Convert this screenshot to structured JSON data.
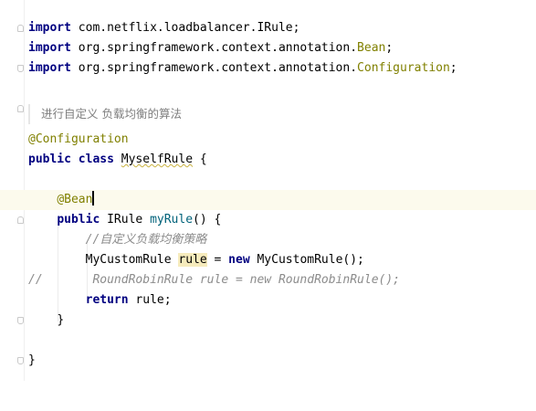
{
  "editor": {
    "imports": {
      "line1": {
        "kw": "import",
        "path": "com.netflix.loadbalancer.IRule;"
      },
      "line2": {
        "kw": "import",
        "path_a": "org.springframework.context.annotation.",
        "path_b": "Bean",
        "path_c": ";"
      },
      "line3": {
        "kw": "import",
        "path_a": "org.springframework.context.annotation.",
        "path_b": "Configuration",
        "path_c": ";"
      }
    },
    "doc_comment": "进行自定义 负载均衡的算法",
    "class_annotation": "@Configuration",
    "class_decl": {
      "kw1": "public",
      "kw2": "class",
      "name": "MyselfRule",
      "brace": "{"
    },
    "bean_annotation": "@Bean",
    "method_decl": {
      "kw": "public",
      "type": "IRule",
      "name": "myRule",
      "rest": "() {"
    },
    "comment1": "//自定义负载均衡策略",
    "stmt1": {
      "type": "MyCustomRule",
      "var": "rule",
      "eq": "=",
      "kw": "new",
      "ctor": "MyCustomRule();"
    },
    "commented_out": {
      "prefix": "//",
      "text": "RoundRobinRule rule = new RoundRobinRule();"
    },
    "return_stmt": {
      "kw": "return",
      "val": "rule;"
    },
    "close_method": "}",
    "close_class": "}"
  },
  "gutter": {
    "bean_icon": "spring-bean-icon"
  },
  "colors": {
    "keyword": "#000080",
    "annotation": "#808000",
    "method": "#00627a",
    "comment": "#8c8c8c",
    "current_line": "#fcfaed",
    "highlight_usage": "#f6ebbc"
  }
}
